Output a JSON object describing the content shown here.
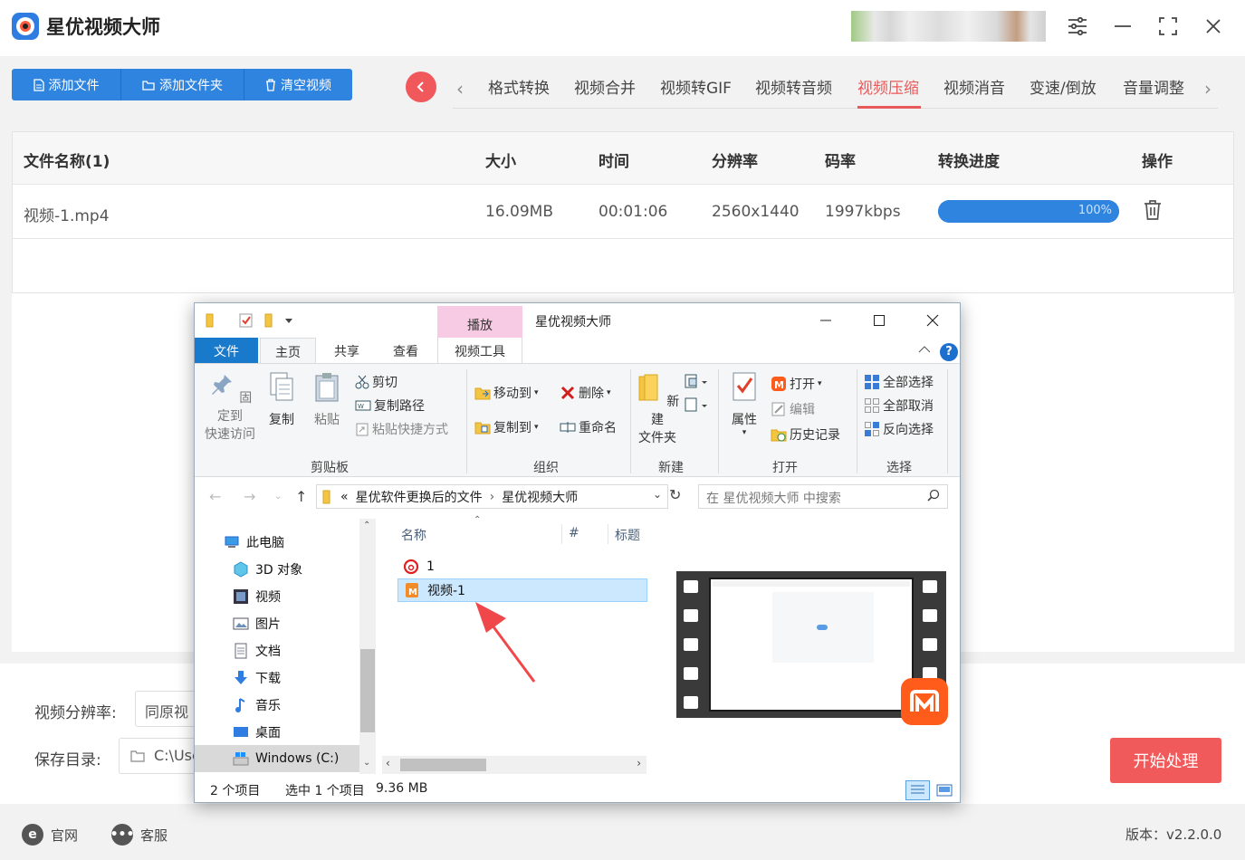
{
  "app": {
    "title": "星优视频大师",
    "version": "版本：v2.2.0.0"
  },
  "toolbar": {
    "add_file": "添加文件",
    "add_folder": "添加文件夹",
    "clear": "清空视频"
  },
  "tabs": [
    {
      "label": "格式转换"
    },
    {
      "label": "视频合并"
    },
    {
      "label": "视频转GIF"
    },
    {
      "label": "视频转音频"
    },
    {
      "label": "视频压缩",
      "active": true
    },
    {
      "label": "视频消音"
    },
    {
      "label": "变速/倒放"
    },
    {
      "label": "音量调整"
    }
  ],
  "table": {
    "headers": {
      "name": "文件名称(1)",
      "size": "大小",
      "time": "时间",
      "resolution": "分辨率",
      "bitrate": "码率",
      "progress": "转换进度",
      "action": "操作"
    },
    "rows": [
      {
        "name": "视频-1.mp4",
        "size": "16.09MB",
        "time": "00:01:06",
        "resolution": "2560x1440",
        "bitrate": "1997kbps",
        "progress_label": "100%",
        "progress": 1.0
      }
    ]
  },
  "settings": {
    "resolution_label": "视频分辨率:",
    "resolution_value": "同原视",
    "save_label": "保存目录:",
    "save_value": "C:\\Use",
    "start_button": "开始处理"
  },
  "footer": {
    "website": "官网",
    "service": "客服"
  },
  "explorer": {
    "title": "星优视频大师",
    "context_tab": "播放",
    "tabs": {
      "file": "文件",
      "home": "主页",
      "share": "共享",
      "view": "查看",
      "video_tools": "视频工具"
    },
    "ribbon": {
      "pin": "固定到\n快速访问",
      "copy": "复制",
      "paste": "粘贴",
      "cut": "剪切",
      "copy_path": "复制路径",
      "paste_shortcut": "粘贴快捷方式",
      "clipboard_group": "剪贴板",
      "move_to": "移动到",
      "copy_to": "复制到",
      "delete": "删除",
      "rename": "重命名",
      "organize_group": "组织",
      "new_folder": "新建\n文件夹",
      "new_group": "新建",
      "properties": "属性",
      "open": "打开",
      "edit": "编辑",
      "history": "历史记录",
      "open_group": "打开",
      "select_all": "全部选择",
      "select_none": "全部取消",
      "invert_select": "反向选择",
      "select_group": "选择"
    },
    "address": {
      "prefix": "«",
      "crumb1": "星优软件更换后的文件",
      "crumb2": "星优视频大师"
    },
    "search_placeholder": "在 星优视频大师 中搜索",
    "nav": {
      "this_pc": "此电脑",
      "objects3d": "3D 对象",
      "videos": "视频",
      "pictures": "图片",
      "documents": "文档",
      "downloads": "下载",
      "music": "音乐",
      "desktop": "桌面",
      "drive_c": "Windows (C:)"
    },
    "columns": {
      "name": "名称",
      "num": "#",
      "title": "标题"
    },
    "files": [
      {
        "name": "1",
        "icon": "netease-music-icon"
      },
      {
        "name": "视频-1",
        "icon": "video-file-icon",
        "selected": true
      }
    ],
    "status": {
      "count": "2 个项目",
      "selected": "选中 1 个项目",
      "size": "9.36 MB"
    }
  },
  "colors": {
    "accent_blue": "#2f84e0",
    "accent_red": "#e85a5a",
    "start_button": "#f05a5a"
  }
}
